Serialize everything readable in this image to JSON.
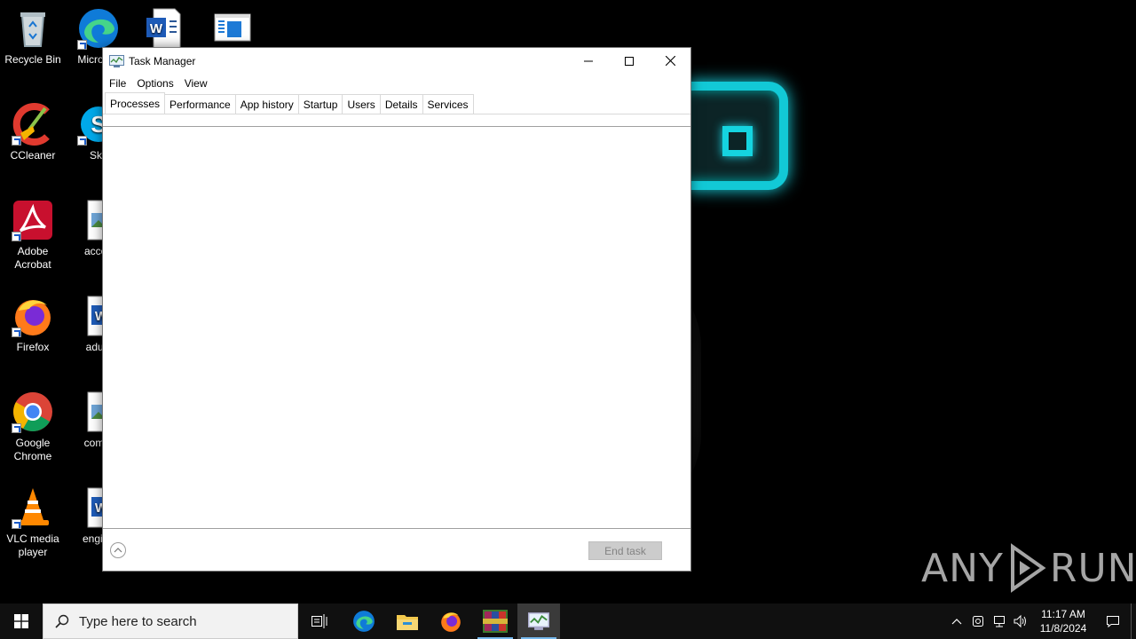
{
  "desktop": {
    "icons": [
      {
        "label": "Recycle Bin"
      },
      {
        "label": "Micro Ed"
      },
      {
        "label": ""
      },
      {
        "label": ""
      },
      {
        "label": "CCleaner"
      },
      {
        "label": "Sky"
      },
      {
        "label": "Adobe Acrobat"
      },
      {
        "label": "accou"
      },
      {
        "label": "Firefox"
      },
      {
        "label": "adultl"
      },
      {
        "label": "Google Chrome"
      },
      {
        "label": "comm"
      },
      {
        "label": "VLC media player"
      },
      {
        "label": "engine"
      }
    ],
    "watermark": "ANY RUN"
  },
  "window": {
    "title": "Task Manager",
    "menu": [
      "File",
      "Options",
      "View"
    ],
    "tabs": [
      "Processes",
      "Performance",
      "App history",
      "Startup",
      "Users",
      "Details",
      "Services"
    ],
    "active_tab": "Processes",
    "end_task_label": "End task"
  },
  "taskbar": {
    "search_placeholder": "Type here to search",
    "pinned": [
      "task-view-icon",
      "edge-icon",
      "file-explorer-icon",
      "firefox-icon",
      "winrar-icon",
      "task-manager-icon"
    ],
    "time": "11:17 AM",
    "date": "11/8/2024"
  },
  "colors": {
    "accent_glow": "#12c9d6",
    "taskbar": "#101010",
    "running_indicator": "#76b9ed"
  }
}
